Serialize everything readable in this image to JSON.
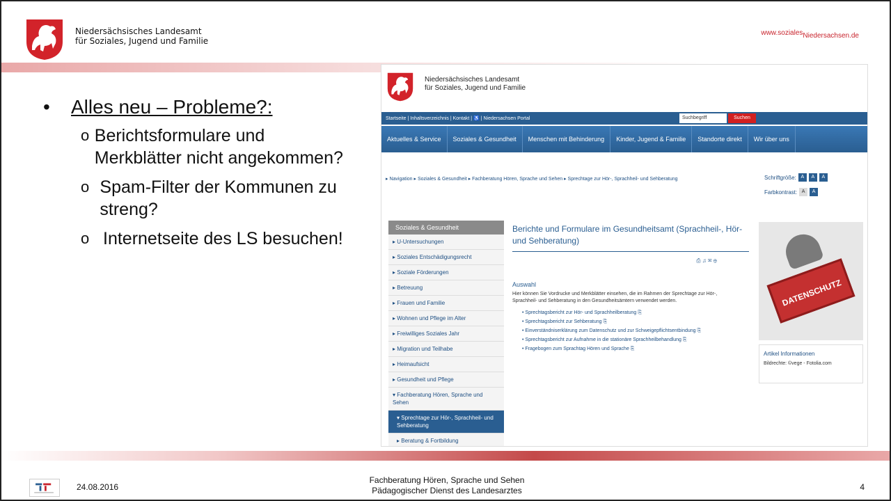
{
  "header": {
    "org_line1": "Niedersächsisches Landesamt",
    "org_line2": "für Soziales, Jugend und Familie",
    "url_prefix": "www.soziales",
    "url_suffix": "Niedersachsen.de"
  },
  "bullets": {
    "main": "Alles neu – Probleme?:",
    "sub": [
      "Berichtsformulare und Merkblätter nicht angekommen?",
      "Spam-Filter der Kommunen zu streng?",
      "Internetseite des LS besuchen!"
    ]
  },
  "screenshot": {
    "org_line1": "Niedersächsisches Landesamt",
    "org_line2": "für Soziales, Jugend und Familie",
    "topnav": "Startseite | Inhaltsverzeichnis | Kontakt | ♿ | Niedersachsen Portal",
    "search_placeholder": "Suchbegriff",
    "search_button": "Suchen",
    "mainnav": [
      "Aktuelles & Service",
      "Soziales & Gesundheit",
      "Menschen mit Behinderung",
      "Kinder, Jugend & Familie",
      "Standorte direkt",
      "Wir über uns"
    ],
    "breadcrumb": "▸ Navigation ▸ Soziales & Gesundheit ▸ Fachberatung Hören, Sprache und Sehen ▸ Sprechtage zur Hör-, Sprachheil- und Sehberatung",
    "schriftgroesse": "Schriftgröße:",
    "farbkontrast": "Farbkontrast:",
    "sidebar_head": "Soziales & Gesundheit",
    "sidebar": [
      "U-Untersuchungen",
      "Soziales Entschädigungsrecht",
      "Soziale Förderungen",
      "Betreuung",
      "Frauen und Familie",
      "Wohnen und Pflege im Alter",
      "Freiwilliges Soziales Jahr",
      "Migration und Teilhabe",
      "Heimaufsicht",
      "Gesundheit und Pflege",
      "Fachberatung Hören, Sprache und Sehen",
      "Sprechtage zur Hör-, Sprachheil- und Sehberatung",
      "Beratung & Fortbildung"
    ],
    "content_title": "Berichte und Formulare im Gesundheitsamt (Sprachheil-, Hör- und Sehberatung)",
    "auswahl": "Auswahl",
    "intro": "Hier können Sie Vordrucke und Merkblätter einsehen, die im Rahmen der Sprechtage zur Hör-, Sprachheil- und Sehberatung in den Gesundheitsämtern verwendet werden.",
    "links": [
      "Sprechtagsbericht zur Hör- und Sprachheilberatung",
      "Sprechtagsbericht zur Sehberatung",
      "Einverständniserklärung zum Datenschutz und zur Schweigepflichtsentbindung",
      "Sprechtagsbericht zur Aufnahme in die stationäre Sprachheilbehandlung",
      "Fragebogen zum Sprachtag Hören und Sprache"
    ],
    "stamp_text": "DATENSCHUTZ",
    "article_head": "Artikel Informationen",
    "article_text": "Bildrechte: ©vege - Fotolia.com"
  },
  "footer": {
    "date": "24.08.2016",
    "line1": "Fachberatung Hören, Sprache und Sehen",
    "line2": "Pädagogischer Dienst des Landesarztes",
    "page": "4"
  },
  "colors": {
    "brand_red": "#c8232c",
    "nav_blue": "#2a5e91"
  }
}
